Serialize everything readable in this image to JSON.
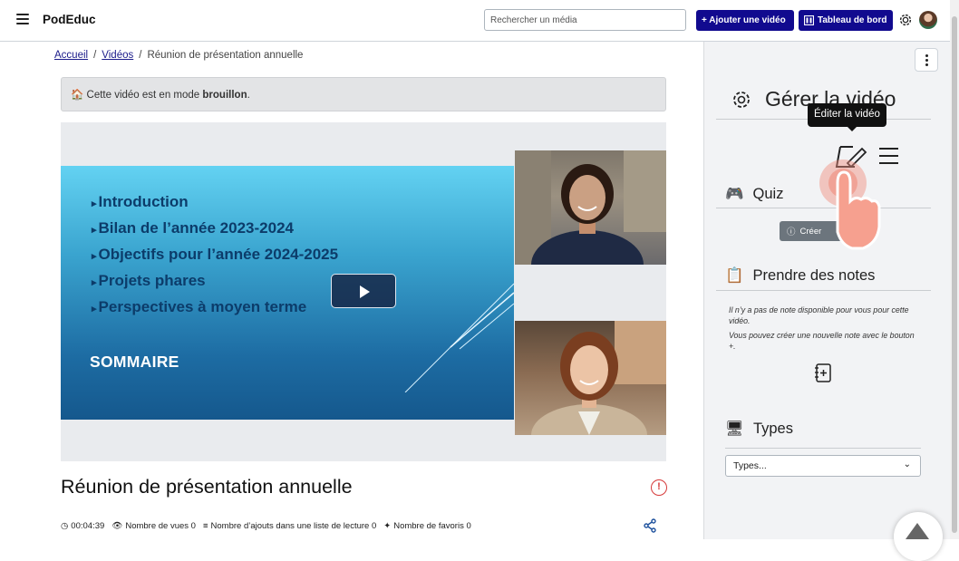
{
  "header": {
    "brand": "PodEduc",
    "search_placeholder": "Rechercher un média",
    "add_video_label": "+ Ajouter une vidéo",
    "dashboard_label": "Tableau de bord",
    "accent_color": "#110a8f"
  },
  "breadcrumb": {
    "home": "Accueil",
    "videos": "Vidéos",
    "current": "Réunion de présentation annuelle",
    "separator": "/"
  },
  "alert": {
    "prefix": "Cette vidéo est en mode",
    "status": "brouillon",
    "suffix": "."
  },
  "slide": {
    "items": [
      "Introduction",
      "Bilan de l’année 2023-2024",
      "Objectifs pour l’année 2024-2025",
      "Projets phares",
      "Perspectives à moyen terme"
    ],
    "title": "SOMMAIRE"
  },
  "video": {
    "title": "Réunion de présentation annuelle",
    "duration": "00:04:39",
    "views": "Nombre de vues 0",
    "playlist_adds": "Nombre d’ajouts dans une liste de lecture 0",
    "favorites": "Nombre de favoris 0"
  },
  "panel": {
    "title": "Gérer la vidéo",
    "tooltip": "Éditer la vidéo",
    "quiz": {
      "heading": "Quiz",
      "button": "Créer"
    },
    "notes": {
      "heading": "Prendre des notes",
      "empty": "Il n’y a pas de note disponible pour vous pour cette vidéo.",
      "hint": "Vous pouvez créer une nouvelle note avec le bouton +."
    },
    "types": {
      "heading": "Types",
      "selected": "Types..."
    }
  }
}
